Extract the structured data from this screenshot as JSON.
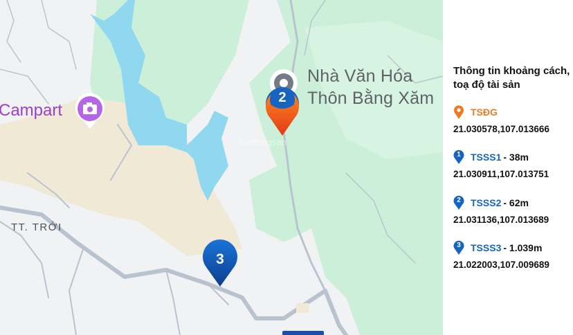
{
  "map": {
    "labels": {
      "poi_line1": "Nhà Văn Hóa",
      "poi_line2": "Thôn Bằng Xăm",
      "campart": "Campart",
      "town": "TT. TRỚI",
      "watermark": "batdongsan"
    },
    "markers": [
      {
        "id": "tsdg",
        "label": "",
        "color": "#f05a22",
        "icon": "location-pin-icon"
      },
      {
        "id": "tsss1",
        "label": "1",
        "color": "#1565c0",
        "icon": "location-pin-icon"
      },
      {
        "id": "tsss2",
        "label": "2",
        "color": "#1565c0",
        "icon": "location-pin-icon"
      },
      {
        "id": "tsss3",
        "label": "3",
        "color": "#1565c0",
        "icon": "location-pin-icon"
      }
    ],
    "colors": {
      "water": "#8fd8ef",
      "forest": "#ccefd9",
      "sand": "#f0e9d6",
      "road": "#b9c3cf",
      "poi_purple": "#b566e6"
    }
  },
  "panel": {
    "title": "Thông tin khoảng cách, toạ độ tài sản",
    "entries": [
      {
        "name": "TSĐG",
        "distance": "",
        "coords": "21.030578,107.013666",
        "pin_label": "",
        "name_color": "#f07a22",
        "pin_color": "#f07a22"
      },
      {
        "name": "TSSS1",
        "distance": "- 38m",
        "coords": "21.030911,107.013751",
        "pin_label": "1",
        "name_color": "#1565c0",
        "pin_color": "#1565c0"
      },
      {
        "name": "TSSS2",
        "distance": "- 62m",
        "coords": "21.031136,107.013689",
        "pin_label": "2",
        "name_color": "#1565c0",
        "pin_color": "#1565c0"
      },
      {
        "name": "TSSS3",
        "distance": "- 1.039m",
        "coords": "21.022003,107.009689",
        "pin_label": "3",
        "name_color": "#1565c0",
        "pin_color": "#1565c0"
      }
    ]
  }
}
